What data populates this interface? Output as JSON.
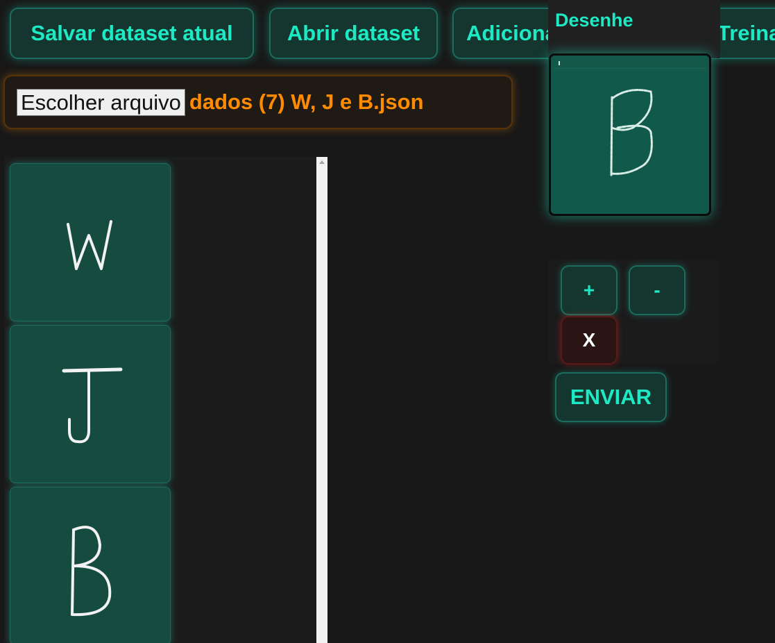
{
  "toolbar": {
    "save_label": "Salvar dataset atual",
    "open_label": "Abrir dataset",
    "add_label": "Adicionar desenho",
    "train_label": "Treinar"
  },
  "file_input": {
    "button_label": "Escolher arquivo",
    "file_name": "dados (7) W, J e B.json"
  },
  "gallery": {
    "items": [
      {
        "letter": "W"
      },
      {
        "letter": "J"
      },
      {
        "letter": "B"
      }
    ]
  },
  "drawing": {
    "title": "Desenhe",
    "current_letter": "B"
  },
  "controls": {
    "plus_label": "+",
    "minus_label": "-",
    "clear_label": "X",
    "send_label": "ENVIAR"
  },
  "colors": {
    "accent": "#1de9c4",
    "file_name": "#ff8c00",
    "background": "#181818",
    "tile": "#164c40"
  }
}
